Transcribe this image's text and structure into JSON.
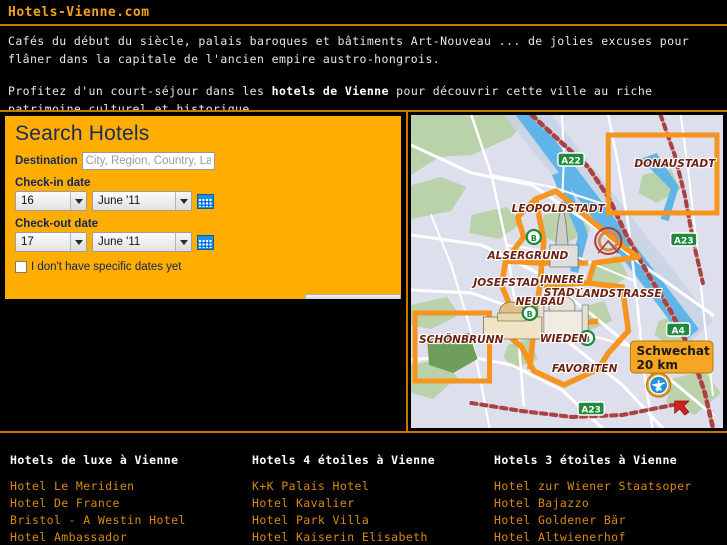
{
  "titlebar": {
    "title": "Hotels-Vienne.com"
  },
  "intro": {
    "paragraph1": "Cafés du début du siècle, palais baroques et bâtiments Art-Nouveau ... de jolies excuses pour flâner dans la capitale de l'ancien empire austro-hongrois.",
    "paragraph2_before": "Profitez d'un court-séjour dans les ",
    "paragraph2_bold": "hotels de Vienne",
    "paragraph2_after": " pour découvrir cette ville au riche patrimoine culturel et historique."
  },
  "search": {
    "heading": "Search Hotels",
    "destination_label": "Destination",
    "destination_value": "",
    "destination_placeholder": "City, Region, Country, Lar",
    "checkin_label": "Check-in date",
    "checkin_day": "16",
    "checkin_month": "June '11",
    "checkout_label": "Check-out date",
    "checkout_day": "17",
    "checkout_month": "June '11",
    "no_dates_label": "I don't have specific dates yet",
    "calendar_icon": "calendar-icon",
    "dropdown_icon": "chevron-down-icon"
  },
  "map": {
    "districts": [
      "LEOPOLDSTADT",
      "ALSERGRUND",
      "JOSEFSTADT",
      "INNERE",
      "STADT",
      "NEUBAU",
      "LANDSTRASSE",
      "WIEDEN",
      "FAVORITEN",
      "DONAUSTADT",
      "SCHÖNBRUNN"
    ],
    "motorways": [
      "A22",
      "A23",
      "A23",
      "A4"
    ],
    "airport_name": "Schwechat",
    "airport_distance": "20 km",
    "airport_icon": "airplane-icon",
    "metro_icon": "metro-station-icon",
    "pointer_icon": "cursor-arrow-icon",
    "colors": {
      "highlight": "#F5951E",
      "land": "#dde0ec",
      "green": "#b8d0a8",
      "water": "#6fb9e8",
      "road": "#ffffff",
      "motorway_badge": "#1f8a3c"
    }
  },
  "footer": {
    "columns": [
      {
        "heading": "Hotels de luxe à Vienne",
        "hotels": [
          "Hotel Le Meridien",
          "Hotel De France",
          "Bristol - A Westin Hotel",
          "Hotel Ambassador"
        ]
      },
      {
        "heading": "Hotels 4 étoiles à Vienne",
        "hotels": [
          "K+K Palais Hotel",
          "Hotel Kavalier",
          "Hotel Park Villa",
          "Hotel Kaiserin Elisabeth"
        ]
      },
      {
        "heading": "Hotels 3 étoiles à Vienne",
        "hotels": [
          "Hotel zur Wiener Staatsoper",
          "Hotel Bajazzo",
          "Hotel Goldener Bär",
          "Hotel Altwienerhof"
        ]
      }
    ]
  }
}
